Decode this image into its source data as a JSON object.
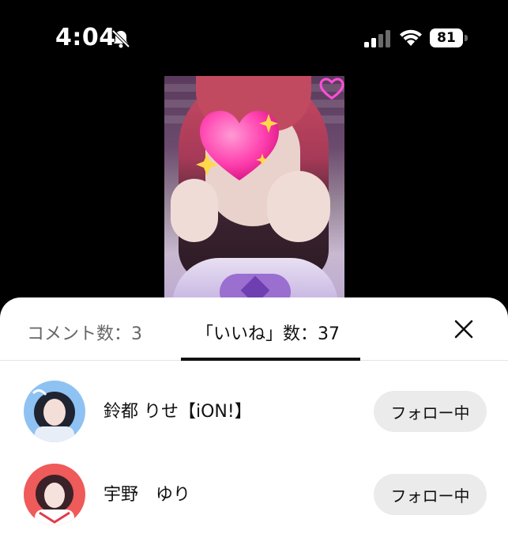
{
  "status_bar": {
    "time": "4:04",
    "battery": "81",
    "icons": [
      "bell-slash-icon",
      "cellular-signal-icon",
      "wifi-icon",
      "battery-icon"
    ]
  },
  "video": {
    "description_icons": [
      "heart-sparkle-sticker-icon",
      "neon-heart-icon"
    ]
  },
  "sheet": {
    "tabs": [
      {
        "label": "コメント数：3",
        "active": false
      },
      {
        "label": "「いいね」数：37",
        "active": true
      }
    ],
    "close_icon": "close-icon",
    "users": [
      {
        "name": "鈴都 りせ【iON!】",
        "button": "フォロー中"
      },
      {
        "name": "宇野　ゆり",
        "button": "フォロー中"
      }
    ]
  },
  "colors": {
    "sheet_bg": "#ffffff",
    "follow_bg": "#ebebeb",
    "tab_active": "#111111",
    "tab_inactive": "#666666"
  }
}
